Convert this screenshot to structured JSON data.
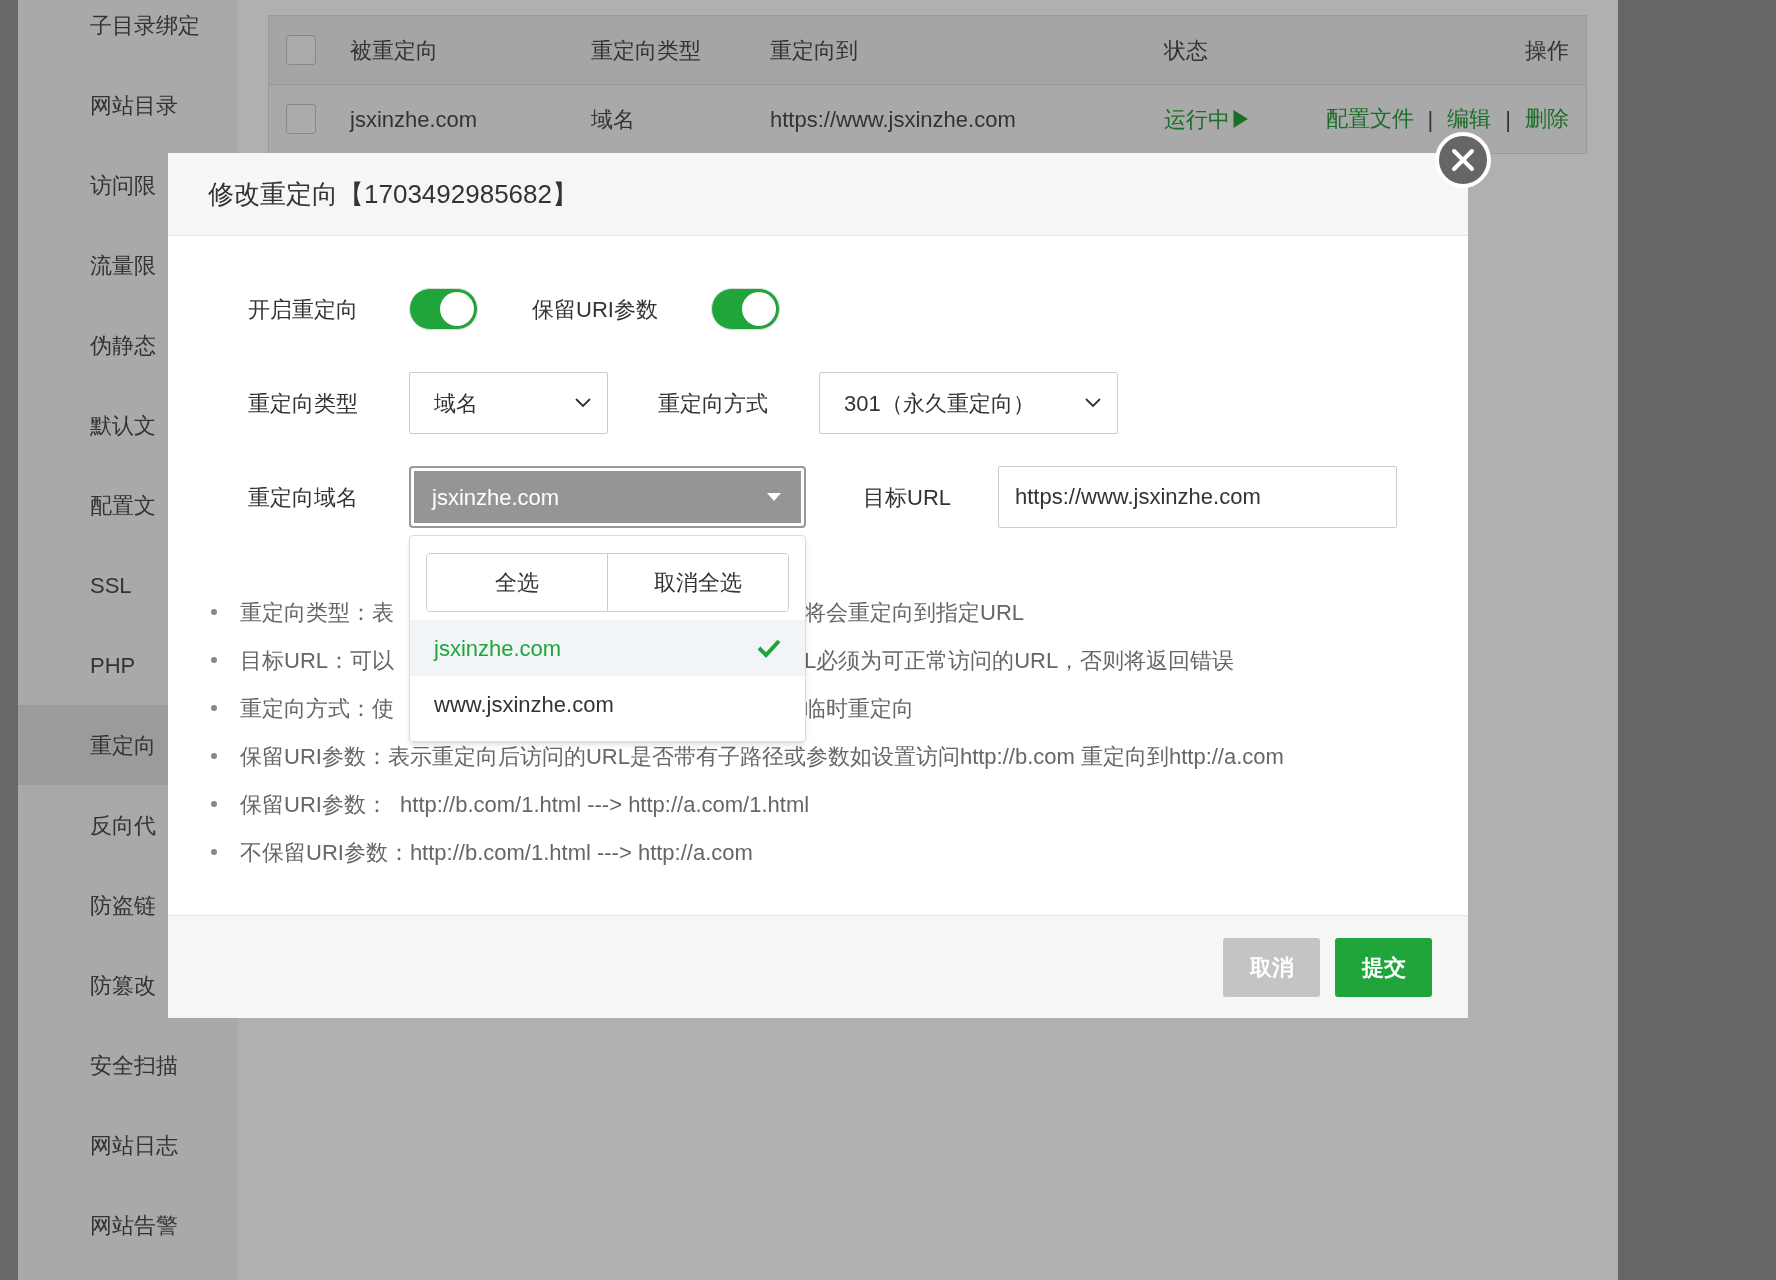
{
  "sidebar": {
    "items": [
      {
        "label": "子目录绑定",
        "selected": false
      },
      {
        "label": "网站目录",
        "selected": false
      },
      {
        "label": "访问限",
        "selected": false
      },
      {
        "label": "流量限",
        "selected": false
      },
      {
        "label": "伪静态",
        "selected": false
      },
      {
        "label": "默认文",
        "selected": false
      },
      {
        "label": "配置文",
        "selected": false
      },
      {
        "label": "SSL",
        "selected": false
      },
      {
        "label": "PHP",
        "selected": false
      },
      {
        "label": "重定向",
        "selected": true
      },
      {
        "label": "反向代",
        "selected": false
      },
      {
        "label": "防盗链",
        "selected": false
      },
      {
        "label": "防篡改",
        "selected": false
      },
      {
        "label": "安全扫描",
        "selected": false
      },
      {
        "label": "网站日志",
        "selected": false
      },
      {
        "label": "网站告警",
        "selected": false
      }
    ]
  },
  "table": {
    "header_checked": false,
    "columns": [
      "被重定向",
      "重定向类型",
      "重定向到",
      "状态",
      "操作"
    ],
    "rows": [
      {
        "checked": false,
        "source": "jsxinzhe.com",
        "type": "域名",
        "target": "https://www.jsxinzhe.com",
        "status": "运行中▶",
        "actions": [
          "配置文件",
          "编辑",
          "删除"
        ],
        "separators": [
          "|",
          "|"
        ]
      }
    ]
  },
  "dialog": {
    "title": "修改重定向【1703492985682】",
    "toggles": [
      {
        "label": "开启重定向",
        "on": true
      },
      {
        "label": "保留URI参数",
        "on": true
      }
    ],
    "type_field": {
      "label": "重定向类型",
      "value": "域名"
    },
    "mode_field": {
      "label": "重定向方式",
      "value": "301（永久重定向）"
    },
    "domain_field": {
      "label": "重定向域名",
      "value": "jsxinzhe.com",
      "expanded": true
    },
    "target_field": {
      "label": "目标URL",
      "value": "https://www.jsxinzhe.com"
    },
    "dropdown": {
      "buttons": [
        "全选",
        "取消全选"
      ],
      "options": [
        {
          "label": "jsxinzhe.com",
          "selected": true
        },
        {
          "label": "www.jsxinzhe.com",
          "selected": false
        }
      ]
    },
    "notes": [
      {
        "parts": [
          "重定向类型：表",
          "将会重定向到指定URL"
        ]
      },
      {
        "parts": [
          "目标URL：可以",
          "L必须为可正常访问的URL，否则将返回错误"
        ]
      },
      {
        "parts": [
          "重定向方式：使",
          "临时重定向"
        ]
      },
      {
        "parts": [
          "保留URI参数：表示重定向后访问的URL是否带有子路径或参数如设置访问http://b.com 重定向到http://a.com"
        ]
      },
      {
        "parts": [
          "保留URI参数：  http://b.com/1.html ---> http://a.com/1.html"
        ]
      },
      {
        "parts": [
          "不保留URI参数：http://b.com/1.html ---> http://a.com"
        ]
      }
    ],
    "buttons": [
      {
        "label": "取消",
        "kind": "cancel"
      },
      {
        "label": "提交",
        "kind": "submit"
      }
    ]
  }
}
